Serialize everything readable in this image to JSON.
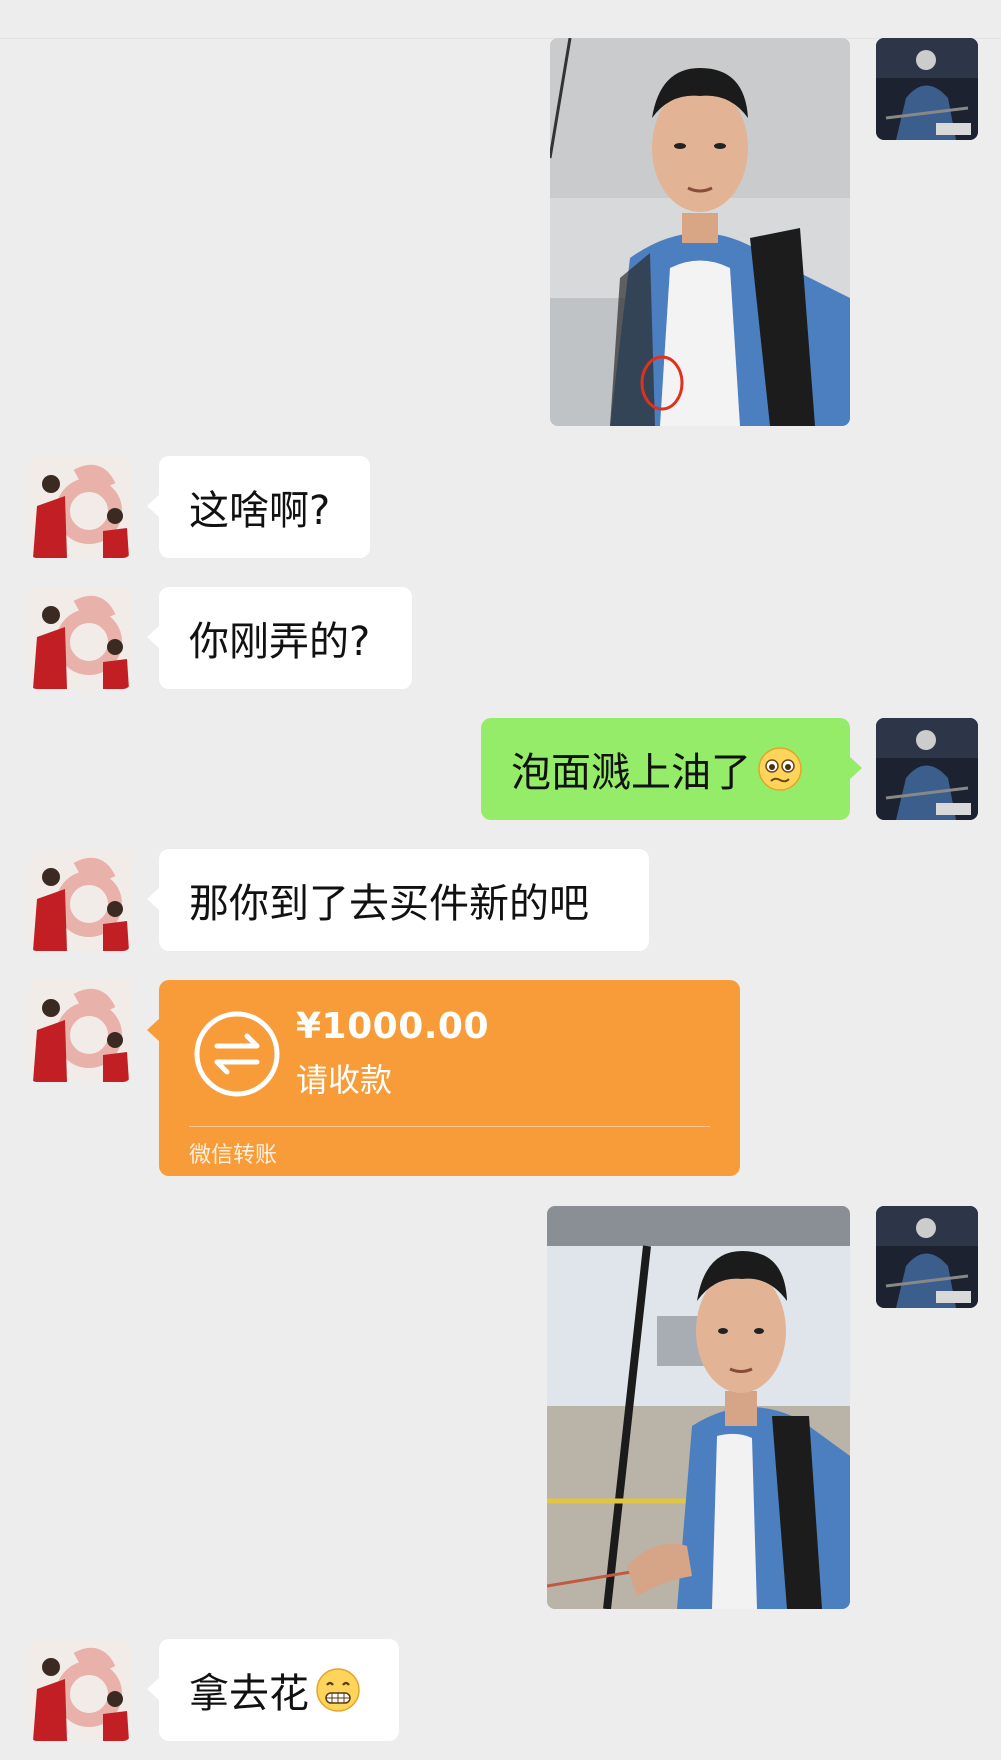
{
  "chat": {
    "messages": [
      {
        "side": "right",
        "type": "image",
        "alt": "selfie-with-stain-circled"
      },
      {
        "side": "left",
        "type": "text",
        "text": "这啥啊?"
      },
      {
        "side": "left",
        "type": "text",
        "text": "你刚弄的?"
      },
      {
        "side": "right",
        "type": "text",
        "text": "泡面溅上油了",
        "emoji": "worried-face"
      },
      {
        "side": "left",
        "type": "text",
        "text": "那你到了去买件新的吧"
      },
      {
        "side": "left",
        "type": "transfer",
        "amount": "¥1000.00",
        "status": "请收款",
        "footer": "微信转账"
      },
      {
        "side": "right",
        "type": "image",
        "alt": "selfie-at-airport"
      },
      {
        "side": "left",
        "type": "text",
        "text": "拿去花",
        "emoji": "grinning-face"
      }
    ]
  },
  "colors": {
    "background": "#ededed",
    "sent_bubble": "#95ec69",
    "received_bubble": "#ffffff",
    "transfer": "#f79c39"
  },
  "icons": {
    "transfer": "transfer-arrows-icon",
    "emoji_1": "worried-face-icon",
    "emoji_2": "grinning-face-icon"
  }
}
